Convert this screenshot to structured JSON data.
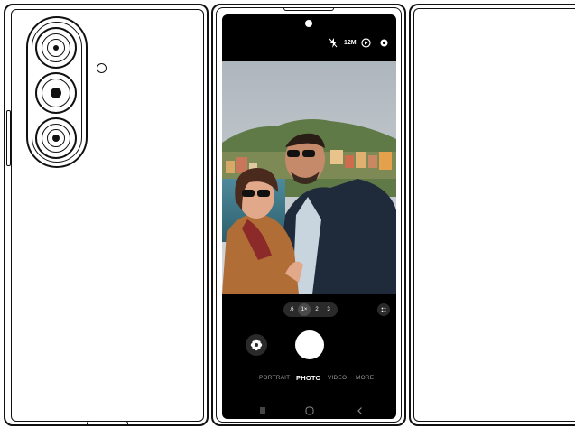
{
  "camera_ui": {
    "settings": {
      "flash_icon": "flash-off-icon",
      "resolution": "12M",
      "motion_icon": "motion-photo-icon",
      "settings_icon": "settings-icon"
    },
    "zoom": {
      "options": [
        ".6",
        "1×",
        "2",
        "3"
      ],
      "selected": "1×"
    },
    "modes": [
      "PORTRAIT",
      "PHOTO",
      "VIDEO",
      "MORE"
    ],
    "active_mode": "PHOTO"
  },
  "colors": {
    "device_outline": "#111111",
    "screen_bg": "#000000",
    "shutter": "#ffffff",
    "zoom_pill": "#2a2a2a"
  }
}
